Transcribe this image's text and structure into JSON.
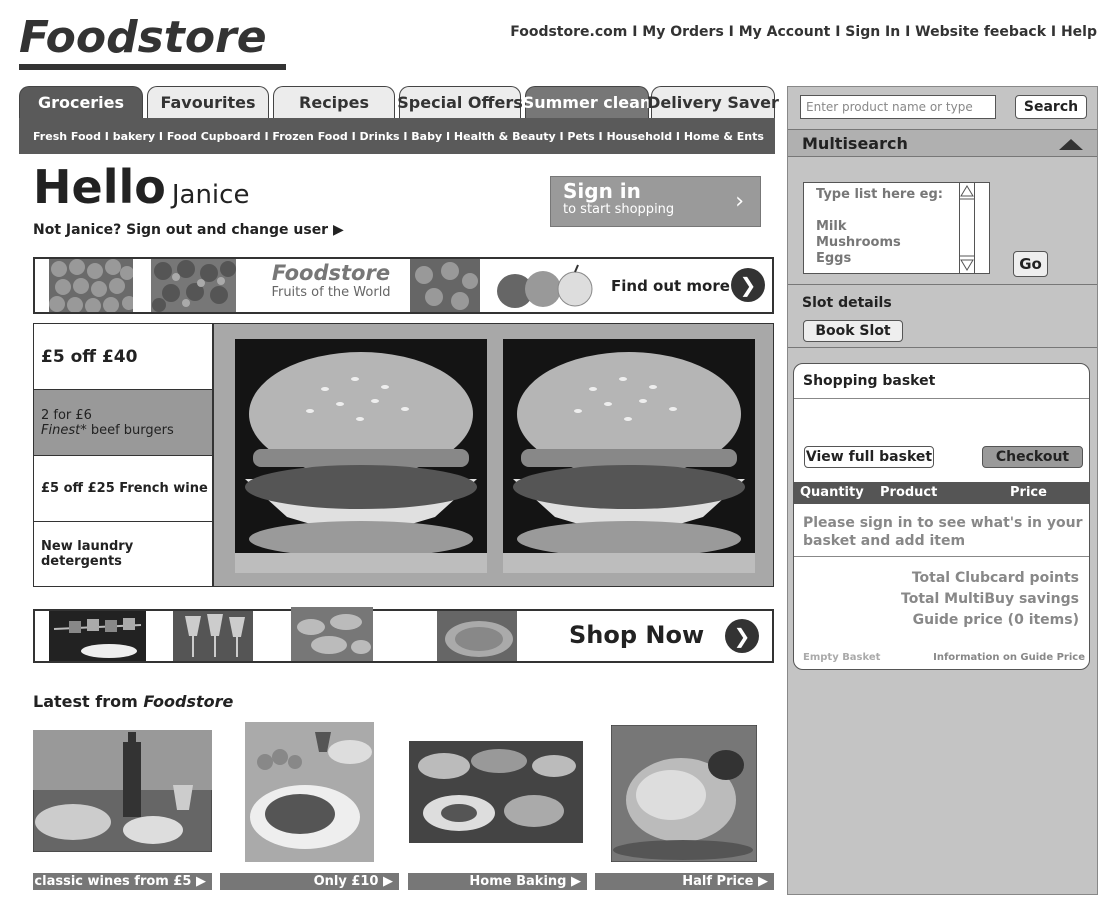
{
  "header": {
    "logo": "Foodstore",
    "links": [
      "Foodstore.com",
      "My Orders",
      "My Account",
      "Sign In",
      "Website feeback",
      "Help"
    ],
    "links_text": "Foodstore.com I My Orders I My Account I Sign In I Website feeback I Help"
  },
  "tabs": [
    {
      "label": "Groceries",
      "state": "active"
    },
    {
      "label": "Favourites",
      "state": "normal"
    },
    {
      "label": "Recipes",
      "state": "normal"
    },
    {
      "label": "Special Offers",
      "state": "normal"
    },
    {
      "label": "Summer clean",
      "state": "dark"
    },
    {
      "label": "Delivery Saver",
      "state": "normal"
    }
  ],
  "subnav": {
    "text": "Fresh Food I bakery I Food Cupboard I Frozen Food I Drinks I Baby I Health & Beauty I Pets I Household I Home & Ents"
  },
  "greeting": {
    "hello": "Hello",
    "name": "Janice",
    "not_user": "Not Janice? Sign out and change user ▶"
  },
  "signin": {
    "title": "Sign in",
    "subtitle": "to start shopping",
    "chevron": "›"
  },
  "banner": {
    "title": "Foodstore",
    "subtitle": "Fruits of the World",
    "cta": "Find out more"
  },
  "offers": [
    {
      "line1": "£5 off £40",
      "line2": ""
    },
    {
      "line1": "2 for £6",
      "line2_italic": "Finest",
      "line2": "* beef burgers"
    },
    {
      "line1": "£5 off £25 French wine",
      "line2": ""
    },
    {
      "line1": "New laundry detergents",
      "line2": ""
    }
  ],
  "shopstrip": {
    "cta": "Shop Now"
  },
  "latest": {
    "heading": "Latest from",
    "brand": "Foodstore",
    "captions": [
      "classic wines from £5 ▶",
      "Only £10 ▶",
      "Home Baking ▶",
      "Half Price ▶"
    ]
  },
  "sidebar": {
    "search_placeholder": "Enter product name or type",
    "search_button": "Search",
    "multisearch_title": "Multisearch",
    "multisearch_text": "Type list here eg:\n\nMilk\nMushrooms\nEggs",
    "go_button": "Go",
    "slot_label": "Slot details",
    "book_slot": "Book Slot",
    "basket": {
      "title": "Shopping basket",
      "view_full": "View full basket",
      "checkout": "Checkout",
      "col_quantity": "Quantity",
      "col_product": "Product",
      "col_price": "Price",
      "message": "Please sign in to see what's in your basket and add item",
      "total_points": "Total Clubcard points",
      "total_multibuy": "Total MultiBuy savings",
      "guide_price": "Guide price (0 items)",
      "empty_basket": "Empty Basket",
      "guide_info": "Information on Guide Price"
    }
  },
  "colors": {
    "dark": "#5a5a5a",
    "mid": "#999999",
    "sidebar": "#c4c4c4"
  }
}
